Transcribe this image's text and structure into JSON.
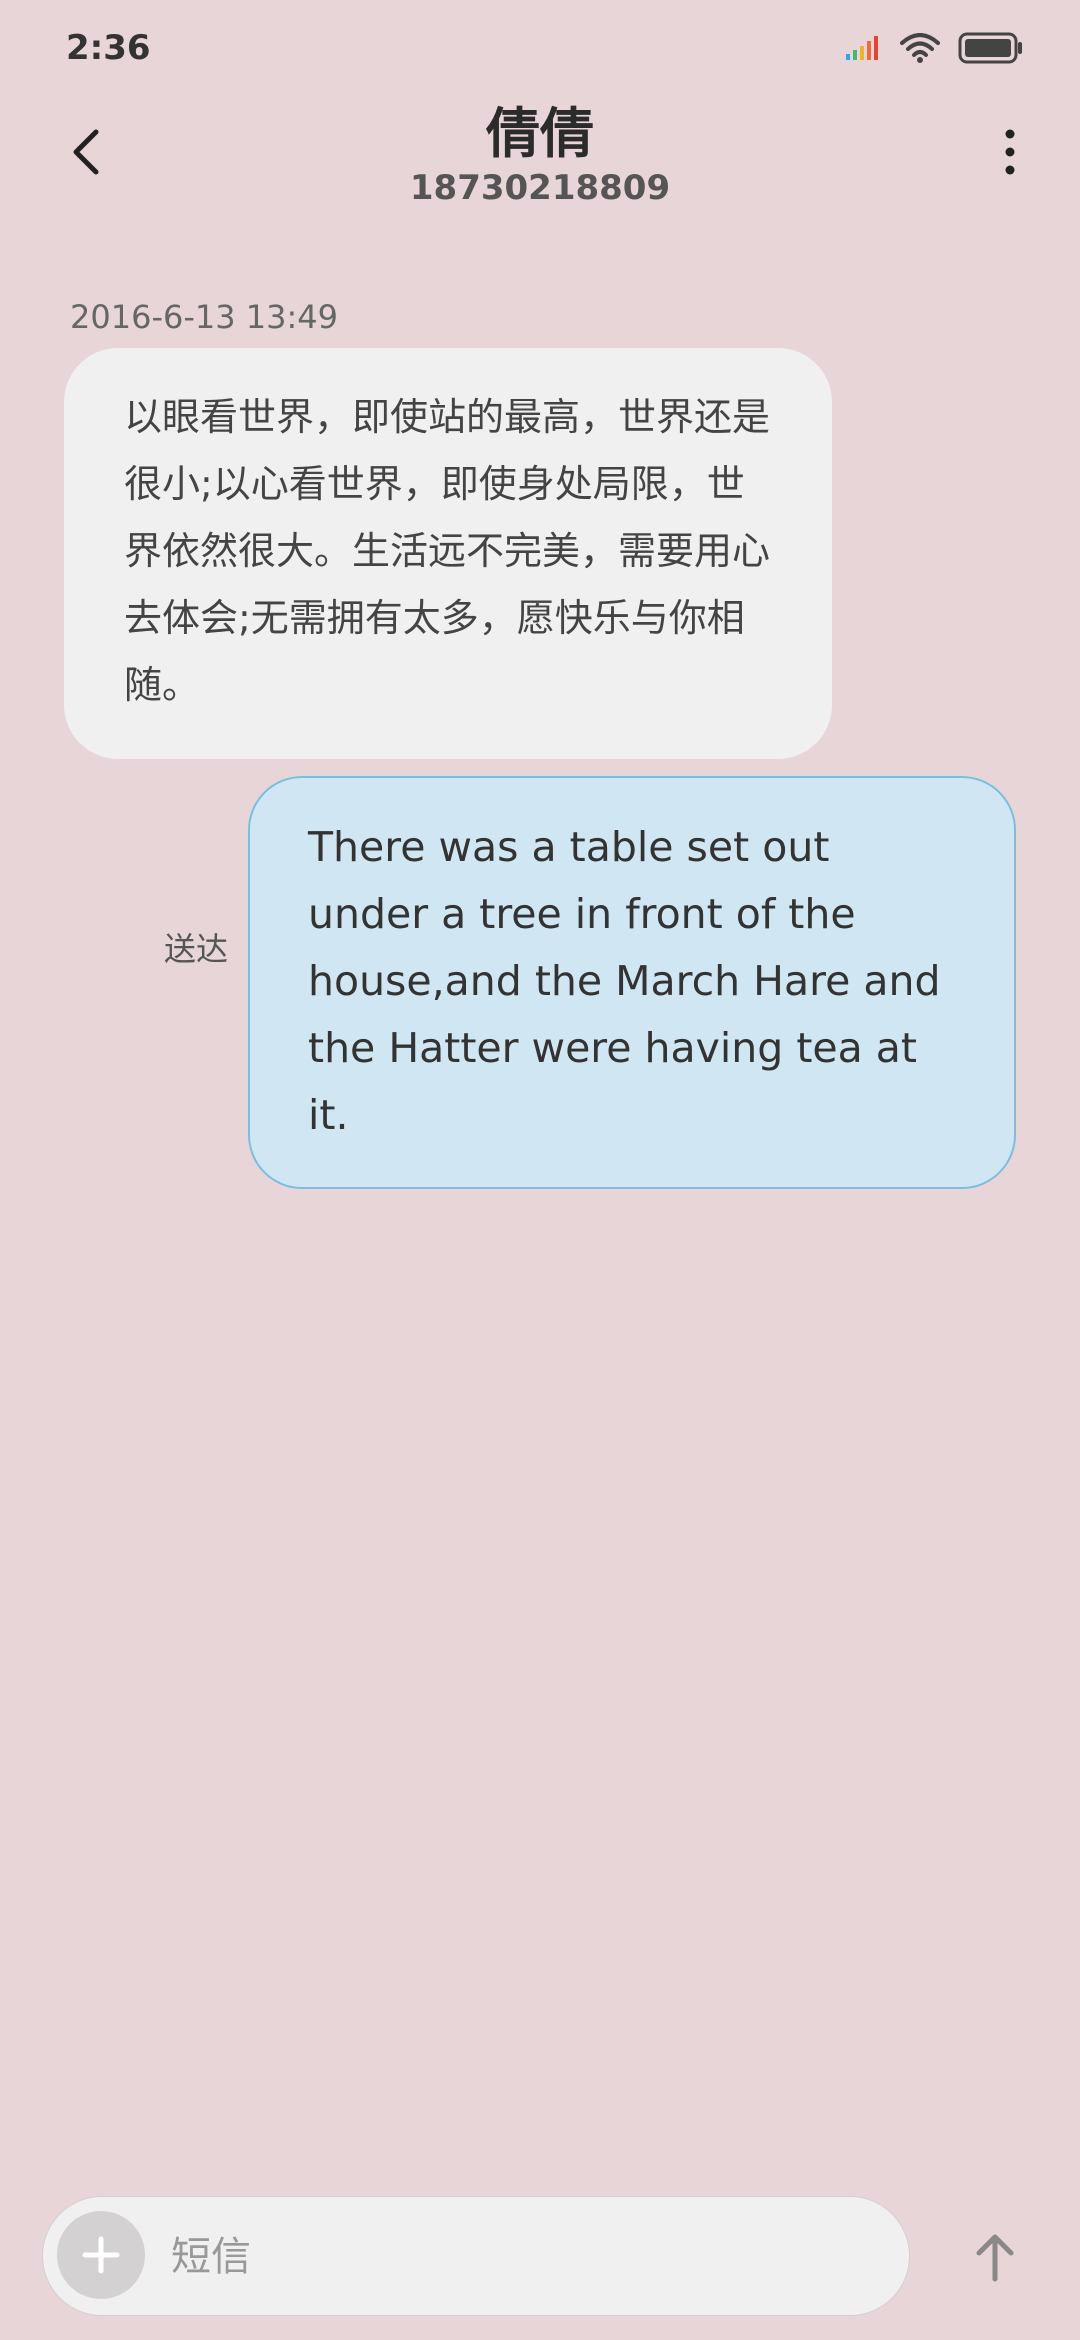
{
  "status_bar": {
    "time": "2:36",
    "icons": [
      "signal-icon",
      "wifi-icon",
      "battery-icon"
    ]
  },
  "header": {
    "contact_name": "倩倩",
    "contact_number": "18730218809",
    "icons": [
      "back-arrow-icon",
      "more-vertical-icon"
    ]
  },
  "messages": [
    {
      "direction": "incoming",
      "timestamp": "2016-6-13 13:49",
      "text": "以眼看世界，即使站的最高，世界还是很小;以心看世界，即使身处局限，世界依然很大。生活远不完美，需要用心去体会;无需拥有太多，愿快乐与你相随。"
    },
    {
      "direction": "outgoing",
      "status": "送达",
      "text": "There was a table set out under a tree in front of the house,and the March Hare and the Hatter were having tea at it."
    }
  ],
  "composer": {
    "placeholder": "短信",
    "value": "",
    "icons": [
      "plus-icon",
      "send-arrow-icon"
    ]
  },
  "colors": {
    "background": "#e7d5d8",
    "incoming_bubble": "#f1f0f0",
    "outgoing_bubble": "#d0e7f3",
    "outgoing_border": "#7fbde0",
    "signal_bars": [
      "#3aa0e6",
      "#44b96a",
      "#f1b32b",
      "#ef6b3a",
      "#e0453a"
    ]
  }
}
